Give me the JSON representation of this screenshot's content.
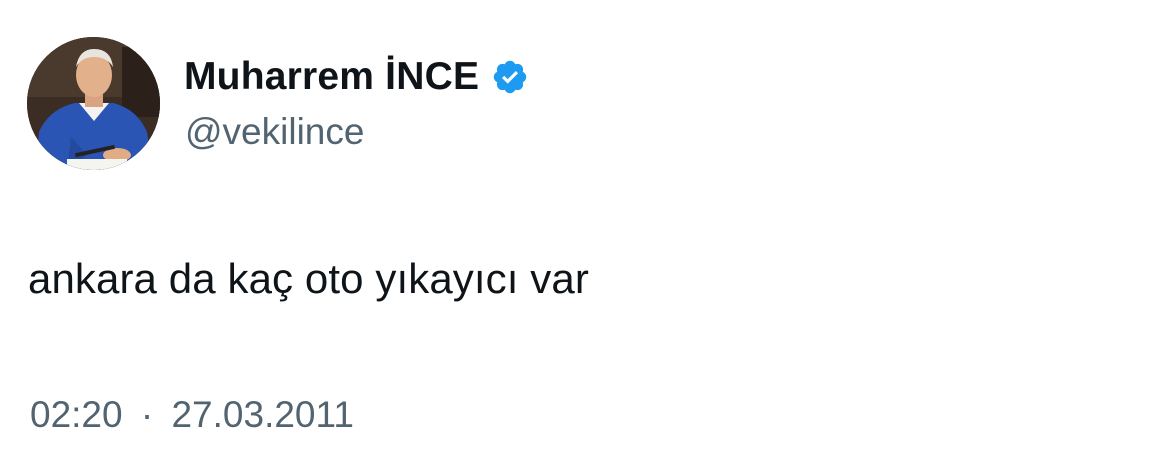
{
  "tweet": {
    "author": {
      "display_name": "Muharrem İNCE",
      "handle": "@vekilince",
      "verified": true,
      "avatar": "profile-photo-man-blue-sweater"
    },
    "text": "ankara da kaç oto yıkayıcı var",
    "time": "02:20",
    "separator": "·",
    "date": "27.03.2011"
  },
  "colors": {
    "text_primary": "#0f1419",
    "text_secondary": "#536471",
    "verified_badge": "#1d9bf0",
    "background": "#ffffff"
  },
  "icons": {
    "verified": "verified-badge-icon"
  }
}
